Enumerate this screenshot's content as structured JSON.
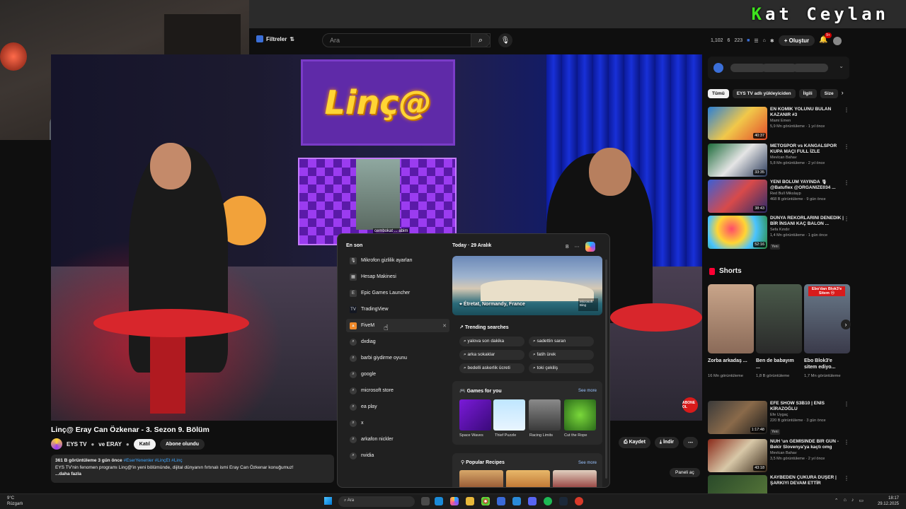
{
  "branding": {
    "k": "K",
    "rest": "at Ceylan"
  },
  "youtube": {
    "filters_label": "Filtreler",
    "search_placeholder": "Ara",
    "stats": [
      "1,102",
      "6",
      "223"
    ],
    "create_label": "Oluştur",
    "notif_count": "9+"
  },
  "video": {
    "logo_text": "Linç@",
    "caption": "cembokat ... abim",
    "corner_badge": "ABONE OL",
    "title": "Linç@ Eray Can Özkenar - 3. Sezon 9. Bölüm",
    "channel": "EYS TV",
    "channel_suffix": "ve ERAY",
    "join_label": "Katıl",
    "subscribed_label": "Abone olundu",
    "save_label": "Kaydet",
    "download_label": "İndir",
    "panel_label": "Paneli aç",
    "desc_stats": "361 B görüntüleme  3 gün önce",
    "desc_tags": "#EserYenenler #LinçEt #Linç",
    "desc_line": "EYS TV'nin fenomen programı Linç@'in yeni bölümünde, dijital dünyanın fırtınalı ismi Eray Can Özkenar konuğumuz!",
    "desc_more": "...daha fazla"
  },
  "sidebar": {
    "chips": [
      "Tümü",
      "EYS TV adlı yükleyiciden",
      "İlgili",
      "Size"
    ],
    "recs": [
      {
        "title": "EN KOMİK YOLUNU BULAN KAZANIR #3",
        "channel": "Mami Emen",
        "meta": "5,9 Mn görüntüleme · 1 yıl önce",
        "duration": "40:37",
        "new": ""
      },
      {
        "title": "METOSPOR vs KANGALSPOR KUPA MAÇI FULL İZLE",
        "channel": "Mevlcan Bahav",
        "meta": "5,8 Mn görüntüleme · 2 yıl önce",
        "duration": "33:35",
        "new": ""
      },
      {
        "title": "YENİ BÖLÜM YAYINDA 🎙 @Batuflex @ORGANIZE034 ...",
        "channel": "Red Bull Mikslayp",
        "meta": "468 B görüntüleme · 9 gün önce",
        "duration": "38:43",
        "new": ""
      },
      {
        "title": "DÜNYA REKORLARINI DENEDİK | BİR İNSANI KAÇ BALON ...",
        "channel": "Sefa Kındır",
        "meta": "1,4 Mn görüntüleme · 1 gün önce",
        "duration": "52:16",
        "new": "Yeni"
      }
    ],
    "shorts_label": "Shorts",
    "shorts": [
      {
        "title": "Zorba arkadaş ...",
        "views": "16 Mn görüntüleme",
        "overlay": ""
      },
      {
        "title": "Ben de babayım ...",
        "views": "1,8 B görüntüleme",
        "overlay": ""
      },
      {
        "title": "Ebo Blok3'e sitem ediyo...",
        "views": "1,7 Mn görüntüleme",
        "overlay": "Ebo'dan Blok3'e Sitem 😢"
      }
    ],
    "recs2": [
      {
        "title": "EFE SHOW S3B10 | ENİS KİRAZOĞLU",
        "channel": "Efe Uygaç",
        "meta": "220 B görüntüleme · 3 gün önce",
        "duration": "1:17:48",
        "new": "Yeni"
      },
      {
        "title": "NUH 'un GEMİSİNDE BİR GÜN - Bekir Slovenya'ya kaçtı omg",
        "channel": "Mevlcan Bahav",
        "meta": "3,5 Mn görüntüleme · 2 yıl önce",
        "duration": "43:18",
        "new": ""
      },
      {
        "title": "KAYBEDEN ÇUKURA DÜŞER | ŞARKIYI DEVAM ETTİR",
        "channel": "",
        "meta": "",
        "duration": "",
        "new": ""
      }
    ]
  },
  "startmenu": {
    "recent_label": "En son",
    "recent": [
      {
        "label": "Mikrofon gizlilik ayarları",
        "icon": "mic-icon",
        "glyph": "🎙"
      },
      {
        "label": "Hesap Makinesi",
        "icon": "calculator-icon",
        "glyph": "▦"
      },
      {
        "label": "Epic Games Launcher",
        "icon": "epic-games-icon",
        "glyph": "E"
      },
      {
        "label": "TradingView",
        "icon": "tradingview-icon",
        "glyph": "TV"
      },
      {
        "label": "FiveM",
        "icon": "fivem-icon",
        "glyph": "▲"
      },
      {
        "label": "dxdiag",
        "icon": "search-icon",
        "glyph": "⌕"
      },
      {
        "label": "barbi giydirme oyunu",
        "icon": "search-icon",
        "glyph": "⌕"
      },
      {
        "label": "google",
        "icon": "search-icon",
        "glyph": "⌕"
      },
      {
        "label": "microsoft store",
        "icon": "search-icon",
        "glyph": "⌕"
      },
      {
        "label": "ea play",
        "icon": "search-icon",
        "glyph": "⌕"
      },
      {
        "label": "x",
        "icon": "search-icon",
        "glyph": "⌕"
      },
      {
        "label": "arkafon nickler",
        "icon": "search-icon",
        "glyph": "⌕"
      },
      {
        "label": "nvidia",
        "icon": "search-icon",
        "glyph": "⌕"
      }
    ],
    "today_label": "Today · 29 Aralık",
    "avatar_letter": "B",
    "hero_location": "Étretat, Normandy, France",
    "hero_source": "Microsoft Bing",
    "trending_label": "Trending searches",
    "trending": [
      "yalova son dakika",
      "sadettin saran",
      "arka sokaklar",
      "fatih ürek",
      "bedelli askerlik ücreti",
      "toki çekiliş"
    ],
    "games_label": "Games for you",
    "see_more": "See more",
    "games": [
      "Space Waves",
      "Thief Puzzle",
      "Racing Limits",
      "Cut the Rope"
    ],
    "recipes_label": "Popular Recipes"
  },
  "taskbar": {
    "temp": "9°C",
    "weather": "Rüzgarlı",
    "search_placeholder": "Ara",
    "time": "18:17",
    "date": "29.12.2025"
  }
}
